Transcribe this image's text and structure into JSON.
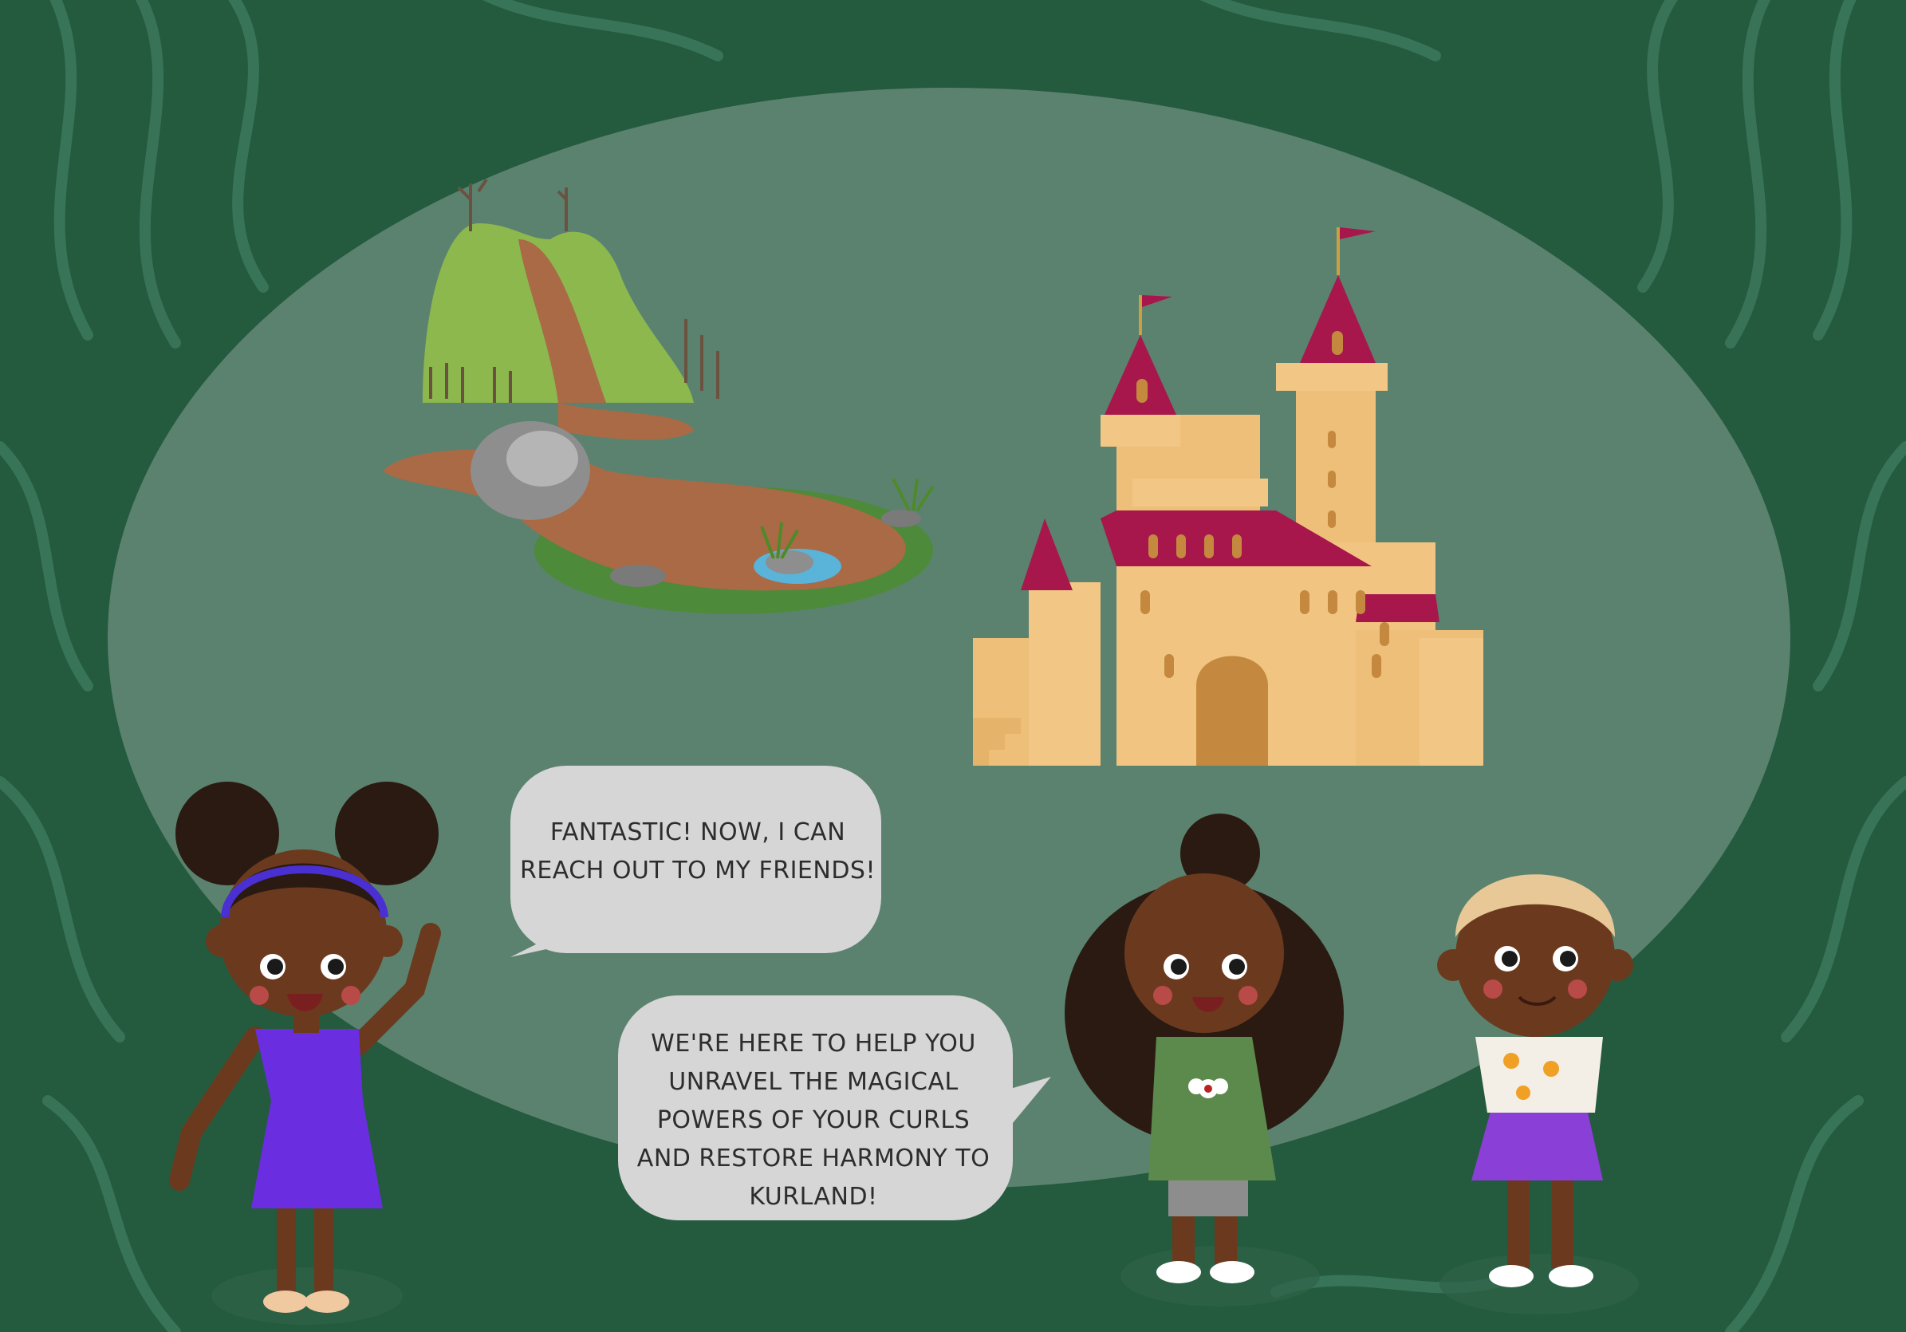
{
  "speech": {
    "bubble_1": "FANTASTIC! NOW, I CAN REACH OUT TO MY FRIENDS!",
    "bubble_2": "WE'RE HERE TO HELP YOU UNRAVEL THE MAGICAL POWERS OF YOUR CURLS AND RESTORE HARMONY TO KURLAND!"
  },
  "colors": {
    "frame": "#245a3e",
    "oval": "#5b826f",
    "bubble": "#d6d6d6",
    "castle_wall": "#eebf78",
    "castle_roof": "#a8174b",
    "grass": "#8cb84e",
    "path": "#a96a45"
  },
  "characters": [
    "girl-purple-dress",
    "girl-green-dress",
    "girl-purple-skirt"
  ]
}
